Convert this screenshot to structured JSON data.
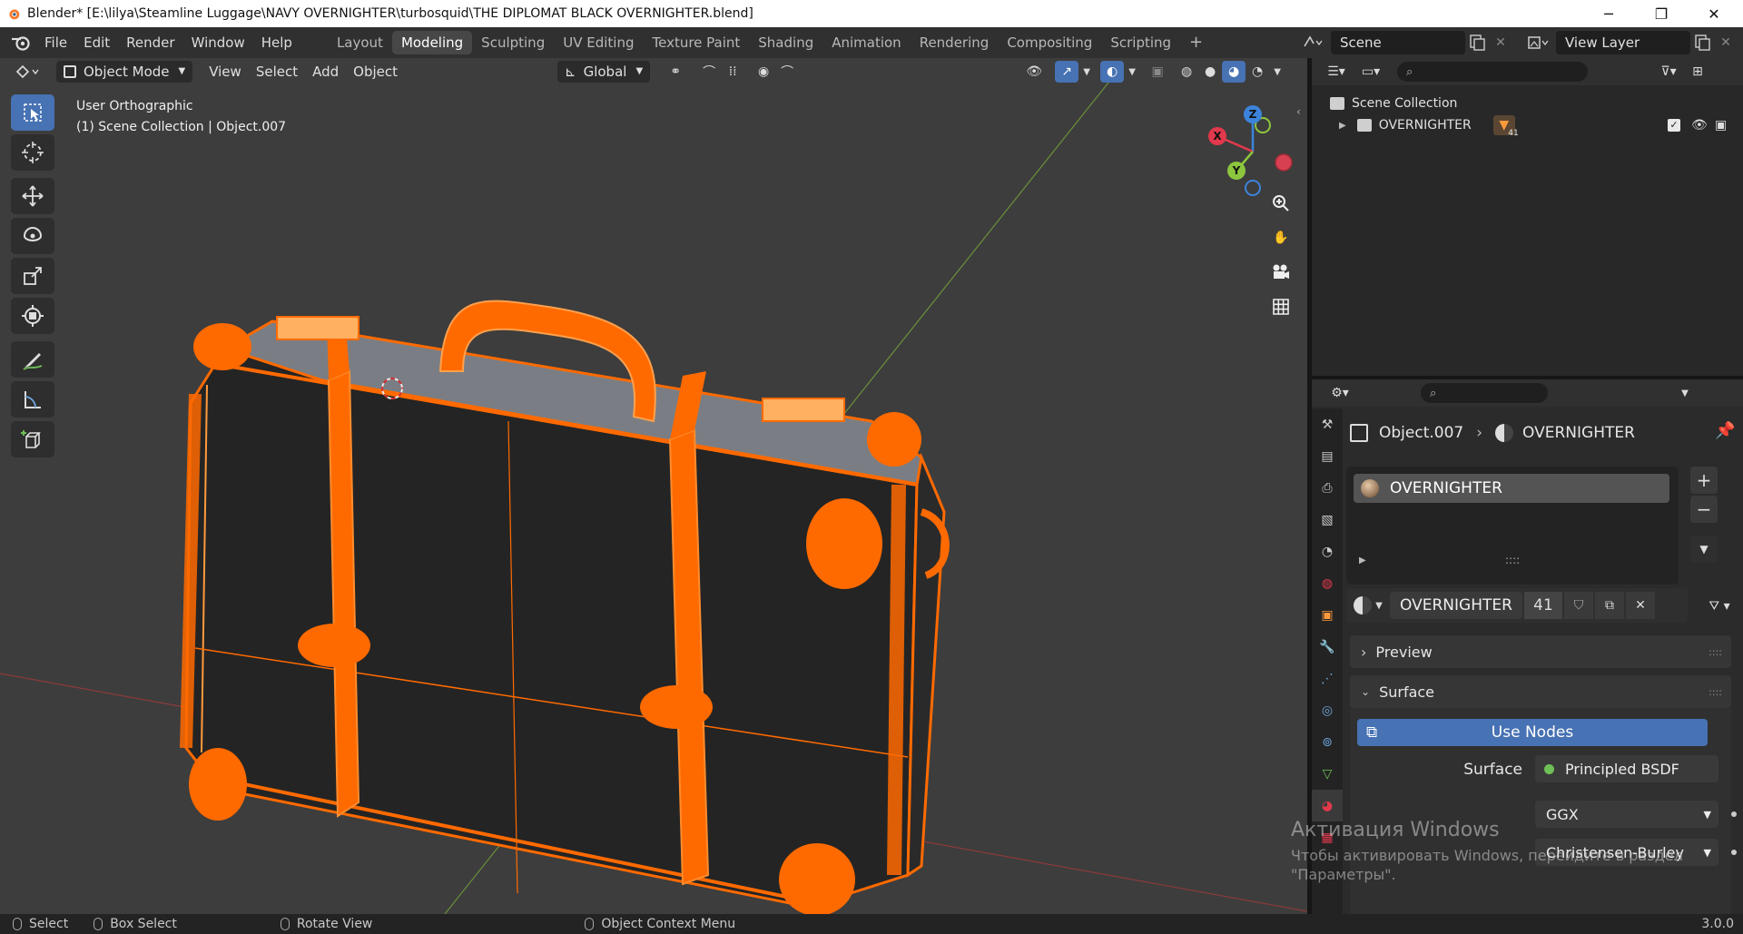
{
  "window": {
    "title": "Blender* [E:\\lilya\\Steamline Luggage\\NAVY OVERNIGHTER\\turbosquid\\THE DIPLOMAT BLACK OVERNIGHTER.blend]",
    "minimize": "─",
    "maximize": "❐",
    "close": "✕"
  },
  "menu": [
    "File",
    "Edit",
    "Render",
    "Window",
    "Help"
  ],
  "workspaces": [
    "Layout",
    "Modeling",
    "Sculpting",
    "UV Editing",
    "Texture Paint",
    "Shading",
    "Animation",
    "Rendering",
    "Compositing",
    "Scripting"
  ],
  "active_workspace": "Modeling",
  "add_workspace": "+",
  "scene": {
    "name": "Scene",
    "view_layer": "View Layer"
  },
  "viewport": {
    "mode": "Object Mode",
    "menus": [
      "View",
      "Select",
      "Add",
      "Object"
    ],
    "transform_orientation": "Global",
    "overlay_title": "User Orthographic",
    "overlay_context": "(1) Scene Collection | Object.007",
    "gizmo_axes": [
      "X",
      "Y",
      "Z"
    ]
  },
  "outliner": {
    "root": "Scene Collection",
    "items": [
      {
        "name": "OVERNIGHTER",
        "badge": "41"
      }
    ]
  },
  "properties": {
    "object_name": "Object.007",
    "material_name": "OVERNIGHTER",
    "slot_name": "OVERNIGHTER",
    "material_field": "OVERNIGHTER",
    "user_count": "41",
    "panels": {
      "preview": "Preview",
      "surface": "Surface"
    },
    "use_nodes": "Use Nodes",
    "surface_label": "Surface",
    "surface_value": "Principled BSDF",
    "distribution": "GGX",
    "subsurface_method": "Christensen-Burley"
  },
  "statusbar": {
    "select": "Select",
    "box_select": "Box Select",
    "rotate_view": "Rotate View",
    "context_menu": "Object Context Menu",
    "version": "3.0.0"
  },
  "watermark": {
    "title": "Активация Windows",
    "line1": "Чтобы активировать Windows, перейдите в раздел",
    "line2": "\"Параметры\"."
  },
  "colors": {
    "selection_orange": "#ff6a00",
    "accent_blue": "#4772b3",
    "axis_x": "#e2394c",
    "axis_y": "#8cc63e",
    "axis_z": "#3c84db"
  }
}
